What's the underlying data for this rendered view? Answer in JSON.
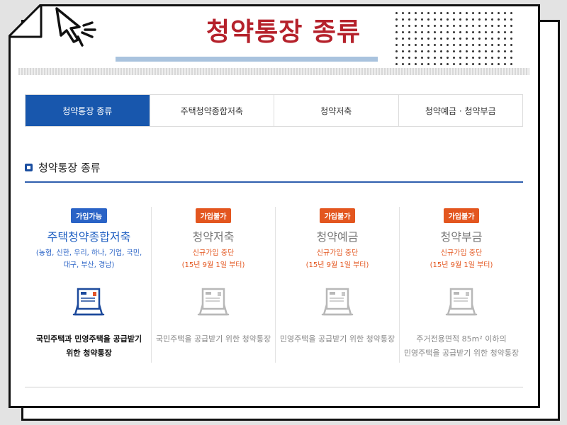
{
  "page_title": "청약통장 종류",
  "tabs": [
    {
      "label": "청약통장 종류",
      "active": true
    },
    {
      "label": "주택청약종합저축",
      "active": false
    },
    {
      "label": "청약저축",
      "active": false
    },
    {
      "label": "청약예금 · 청약부금",
      "active": false
    }
  ],
  "section_title": "청약통장 종류",
  "cards": [
    {
      "badge": "가입가능",
      "name": "주택청약종합저축",
      "sub_line1": "(농협, 신한, 우리, 하나, 기업, 국민,",
      "sub_line2": "대구, 부산, 경남)",
      "desc_line1": "국민주택과 민영주택을 공급받기",
      "desc_line2": "위한 청약통장"
    },
    {
      "badge": "가입불가",
      "name": "청약저축",
      "sub_line1": "신규가입 중단",
      "sub_line2": "(15년 9월 1일 부터)",
      "desc_line1": "국민주택을 공급받기 위한 청약통장",
      "desc_line2": ""
    },
    {
      "badge": "가입불가",
      "name": "청약예금",
      "sub_line1": "신규가입 중단",
      "sub_line2": "(15년 9월 1일 부터)",
      "desc_line1": "민영주택을 공급받기 위한 청약통장",
      "desc_line2": ""
    },
    {
      "badge": "가입불가",
      "name": "청약부금",
      "sub_line1": "신규가입 중단",
      "sub_line2": "(15년 9월 1일 부터)",
      "desc_line1": "주거전용면적 85m² 이하의",
      "desc_line2": "민영주택을 공급받기 위한 청약통장"
    }
  ],
  "colors": {
    "title": "#b5212b",
    "active_tab": "#1857ad",
    "badge_ok": "#2a63c6",
    "badge_no": "#e3561f"
  },
  "icons": [
    "cursor-click-icon",
    "bankbook-icon"
  ]
}
